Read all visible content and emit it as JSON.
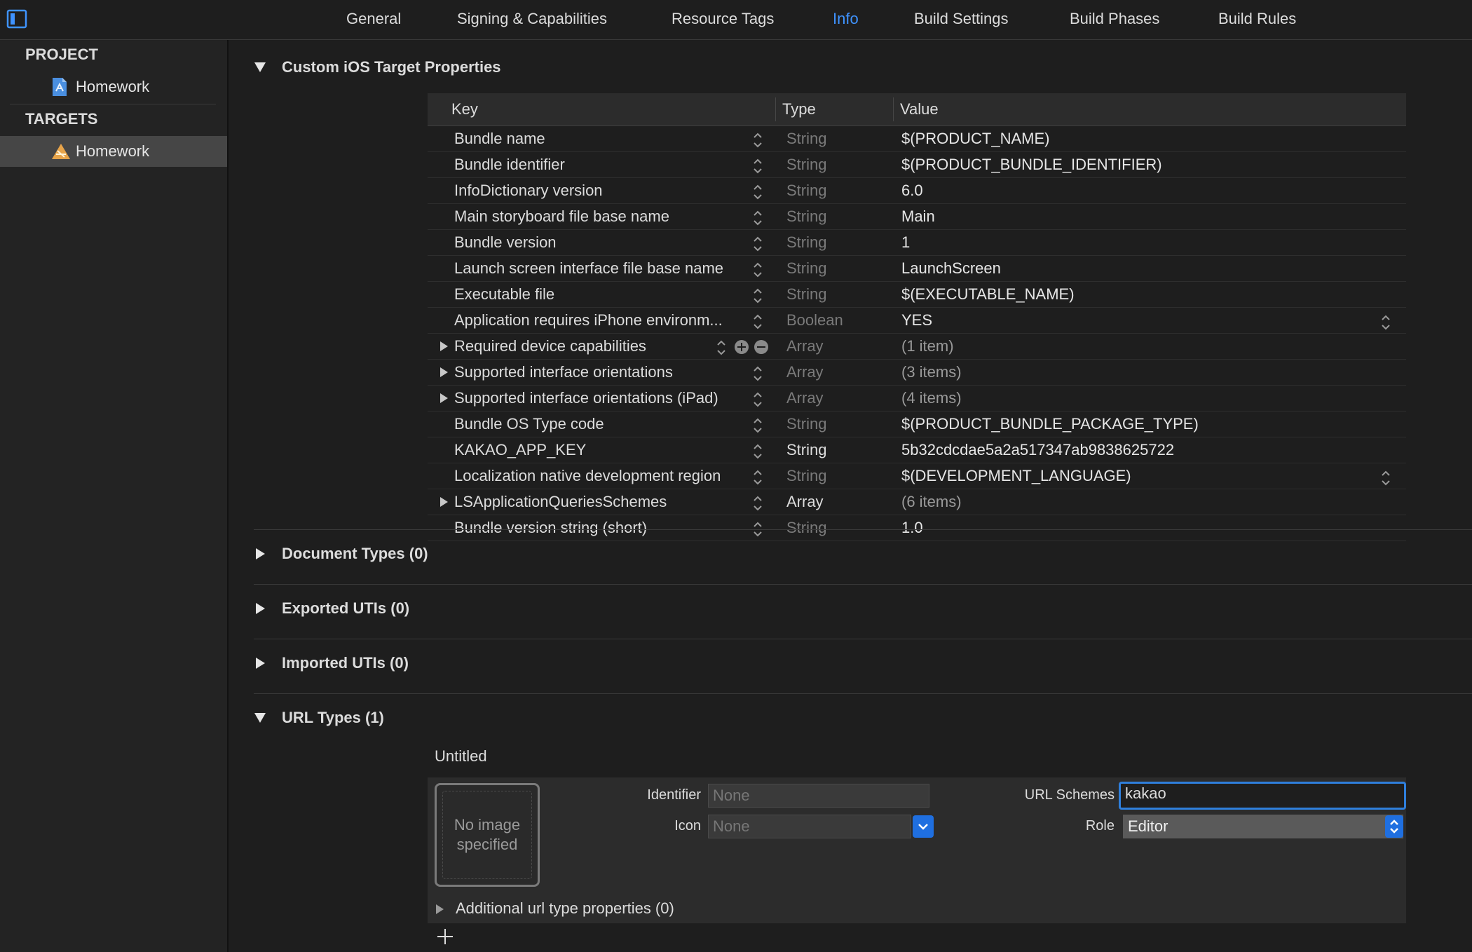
{
  "toolbar": {
    "tabs": [
      {
        "label": "General"
      },
      {
        "label": "Signing & Capabilities"
      },
      {
        "label": "Resource Tags"
      },
      {
        "label": "Info"
      },
      {
        "label": "Build Settings"
      },
      {
        "label": "Build Phases"
      },
      {
        "label": "Build Rules"
      }
    ],
    "active_tab": "Info"
  },
  "sidebar": {
    "project_heading": "PROJECT",
    "project_item": "Homework",
    "targets_heading": "TARGETS",
    "target_item": "Homework"
  },
  "custom_properties": {
    "title": "Custom iOS Target Properties",
    "columns": {
      "key": "Key",
      "type": "Type",
      "value": "Value"
    },
    "rows": [
      {
        "key": "Bundle name",
        "type": "String",
        "value": "$(PRODUCT_NAME)"
      },
      {
        "key": "Bundle identifier",
        "type": "String",
        "value": "$(PRODUCT_BUNDLE_IDENTIFIER)"
      },
      {
        "key": "InfoDictionary version",
        "type": "String",
        "value": "6.0"
      },
      {
        "key": "Main storyboard file base name",
        "type": "String",
        "value": "Main"
      },
      {
        "key": "Bundle version",
        "type": "String",
        "value": "1"
      },
      {
        "key": "Launch screen interface file base name",
        "type": "String",
        "value": "LaunchScreen"
      },
      {
        "key": "Executable file",
        "type": "String",
        "value": "$(EXECUTABLE_NAME)"
      },
      {
        "key": "Application requires iPhone environm...",
        "type": "Boolean",
        "value": "YES"
      },
      {
        "key": "Required device capabilities",
        "type": "Array",
        "value": "(1 item)"
      },
      {
        "key": "Supported interface orientations",
        "type": "Array",
        "value": "(3 items)"
      },
      {
        "key": "Supported interface orientations (iPad)",
        "type": "Array",
        "value": "(4 items)"
      },
      {
        "key": "Bundle OS Type code",
        "type": "String",
        "value": "$(PRODUCT_BUNDLE_PACKAGE_TYPE)"
      },
      {
        "key": "KAKAO_APP_KEY",
        "type": "String",
        "value": "5b32cdcdae5a2a517347ab9838625722"
      },
      {
        "key": "Localization native development region",
        "type": "String",
        "value": "$(DEVELOPMENT_LANGUAGE)"
      },
      {
        "key": "LSApplicationQueriesSchemes",
        "type": "Array",
        "value": "(6 items)"
      },
      {
        "key": "Bundle version string (short)",
        "type": "String",
        "value": "1.0"
      }
    ]
  },
  "sections": {
    "document_types": "Document Types (0)",
    "exported_utis": "Exported UTIs (0)",
    "imported_utis": "Imported UTIs (0)",
    "url_types": "URL Types (1)"
  },
  "url_type": {
    "name": "Untitled",
    "image_placeholder": "No image specified",
    "identifier_label": "Identifier",
    "identifier_placeholder": "None",
    "icon_label": "Icon",
    "icon_value": "None",
    "url_schemes_label": "URL Schemes",
    "url_schemes_value": "kakao",
    "role_label": "Role",
    "role_value": "Editor",
    "additional_label": "Additional url type properties (0)"
  },
  "colors": {
    "accent": "#3f93ff",
    "background": "#1e1e1e",
    "panel": "#2c2c2c"
  }
}
